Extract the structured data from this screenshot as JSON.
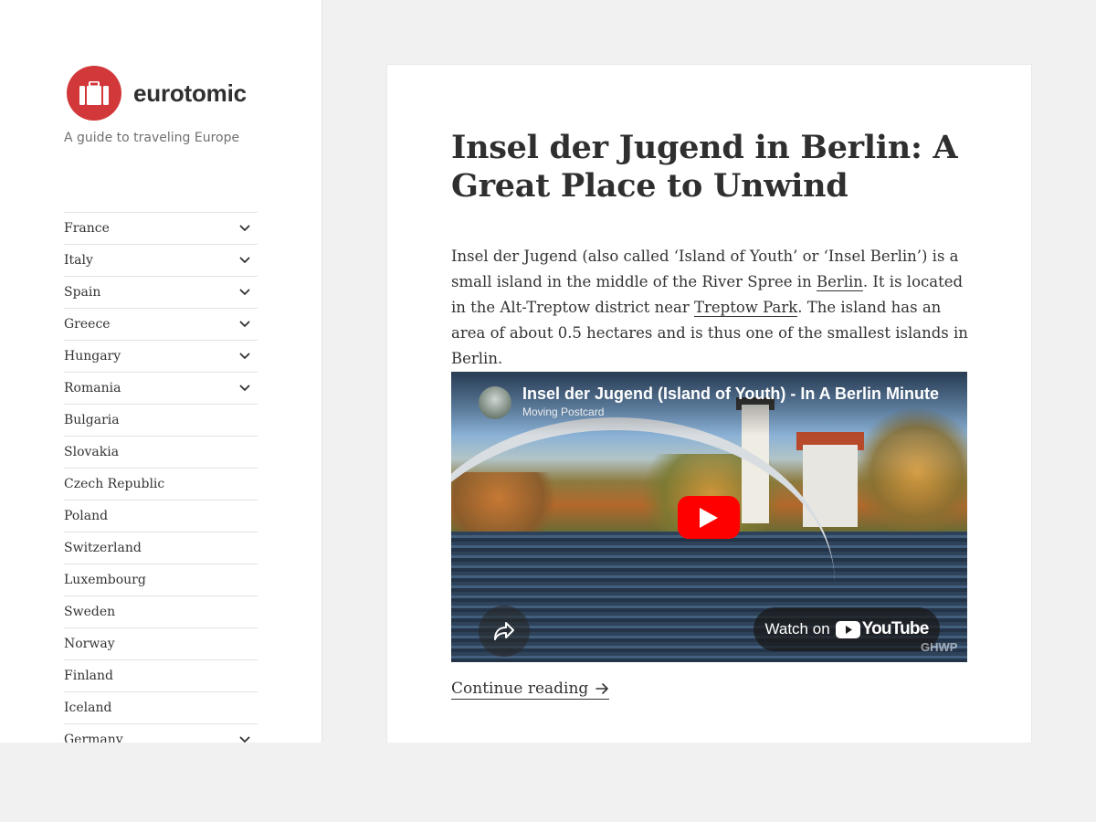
{
  "site": {
    "title": "eurotomic",
    "description": "A guide to traveling Europe",
    "logo_icon": "suitcase-icon",
    "logo_color": "#d2373a"
  },
  "menu": [
    {
      "label": "France",
      "has_submenu": true
    },
    {
      "label": "Italy",
      "has_submenu": true
    },
    {
      "label": "Spain",
      "has_submenu": true
    },
    {
      "label": "Greece",
      "has_submenu": true
    },
    {
      "label": "Hungary",
      "has_submenu": true
    },
    {
      "label": "Romania",
      "has_submenu": true
    },
    {
      "label": "Bulgaria",
      "has_submenu": false
    },
    {
      "label": "Slovakia",
      "has_submenu": false
    },
    {
      "label": "Czech Republic",
      "has_submenu": false
    },
    {
      "label": "Poland",
      "has_submenu": false
    },
    {
      "label": "Switzerland",
      "has_submenu": false
    },
    {
      "label": "Luxembourg",
      "has_submenu": false
    },
    {
      "label": "Sweden",
      "has_submenu": false
    },
    {
      "label": "Norway",
      "has_submenu": false
    },
    {
      "label": "Finland",
      "has_submenu": false
    },
    {
      "label": "Iceland",
      "has_submenu": false
    },
    {
      "label": "Germany",
      "has_submenu": true
    }
  ],
  "post": {
    "title": "Insel der Jugend in Berlin: A Great Place to Unwind",
    "body": {
      "part1": "Insel der Jugend (also called ‘Island of Youth’ or ‘Insel Berlin’) is a small island in the middle of the River Spree in ",
      "link1": "Berlin",
      "part2": ". It is located in the Alt-Treptow district near ",
      "link2": "Treptow Park",
      "part3": ". The island has an area of about 0.5 hectares and is thus one of the smallest islands in Berlin."
    },
    "video": {
      "title": "Insel der Jugend (Island of Youth) - In A Berlin Minute",
      "channel": "Moving Postcard",
      "watch_on": "Watch on",
      "youtube_word": "YouTube",
      "watermark": "GHWP",
      "play_color": "#ff0000"
    },
    "continue_label": "Continue reading",
    "continue_icon": "arrow-right-icon"
  }
}
